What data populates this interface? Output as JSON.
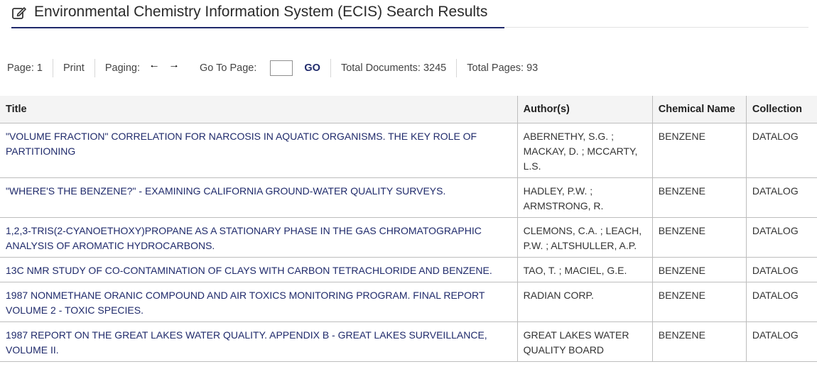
{
  "header": {
    "title": "Environmental Chemistry Information System (ECIS) Search Results",
    "icon": "edit-icon"
  },
  "toolbar": {
    "page_label": "Page: 1",
    "print_label": "Print",
    "paging_label": "Paging:",
    "prev_icon": "arrow-left-icon",
    "next_icon": "arrow-right-icon",
    "goto_label": "Go To Page:",
    "goto_value": "",
    "go_label": "GO",
    "total_documents": "Total Documents: 3245",
    "total_pages": "Total Pages: 93"
  },
  "table": {
    "headers": [
      "Title",
      "Author(s)",
      "Chemical Name",
      "Collection"
    ],
    "rows": [
      {
        "title": "\"VOLUME FRACTION\" CORRELATION FOR NARCOSIS IN AQUATIC ORGANISMS. THE KEY ROLE OF PARTITIONING",
        "authors": "ABERNETHY, S.G. ; MACKAY, D. ; MCCARTY, L.S.",
        "chemical": "BENZENE",
        "collection": "DATALOG"
      },
      {
        "title": "\"WHERE'S THE BENZENE?\" - EXAMINING CALIFORNIA GROUND-WATER QUALITY SURVEYS.",
        "authors": "HADLEY, P.W. ; ARMSTRONG, R.",
        "chemical": "BENZENE",
        "collection": "DATALOG"
      },
      {
        "title": "1,2,3-TRIS(2-CYANOETHOXY)PROPANE AS A STATIONARY PHASE IN THE GAS CHROMATOGRAPHIC ANALYSIS OF AROMATIC HYDROCARBONS.",
        "authors": "CLEMONS, C.A. ; LEACH, P.W. ; ALTSHULLER, A.P.",
        "chemical": "BENZENE",
        "collection": "DATALOG"
      },
      {
        "title": "13C NMR STUDY OF CO-CONTAMINATION OF CLAYS WITH CARBON TETRACHLORIDE AND BENZENE.",
        "authors": "TAO, T. ; MACIEL, G.E.",
        "chemical": "BENZENE",
        "collection": "DATALOG"
      },
      {
        "title": "1987 NONMETHANE ORANIC COMPOUND AND AIR TOXICS MONITORING PROGRAM. FINAL REPORT VOLUME 2 - TOXIC SPECIES.",
        "authors": "RADIAN CORP.",
        "chemical": "BENZENE",
        "collection": "DATALOG"
      },
      {
        "title": "1987 REPORT ON THE GREAT LAKES WATER QUALITY. APPENDIX B - GREAT LAKES SURVEILLANCE, VOLUME II.",
        "authors": "GREAT LAKES WATER QUALITY BOARD",
        "chemical": "BENZENE",
        "collection": "DATALOG"
      }
    ]
  },
  "colors": {
    "accent": "#1f2a6b",
    "header_bg": "#f4f4f4",
    "border": "#bdbdbd"
  }
}
